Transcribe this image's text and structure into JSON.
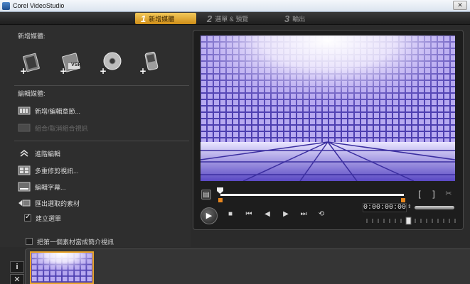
{
  "window": {
    "title": "Corel VideoStudio",
    "close_glyph": "✕"
  },
  "steps": [
    {
      "num": "1",
      "label": "新增媒體",
      "active": true
    },
    {
      "num": "2",
      "label": "選單 & 預覽",
      "active": false
    },
    {
      "num": "3",
      "label": "輸出",
      "active": false
    }
  ],
  "left": {
    "add_media_label": "新增媒體:",
    "capture_icons": [
      "add-video-icon",
      "add-vsp-icon",
      "add-disc-icon",
      "add-device-icon"
    ],
    "vsp_badge": "VSP",
    "edit_media_label": "編輯媒體:",
    "edit_items": [
      {
        "label": "新增/編輯章節...",
        "disabled": false
      },
      {
        "label": "組合/取消組合視訊",
        "disabled": true
      }
    ],
    "advanced_label": "進階編輯",
    "advanced_items": [
      {
        "label": "多重修剪視訊..."
      },
      {
        "label": "編輯字幕..."
      },
      {
        "label": "匯出選取的素材"
      }
    ],
    "create_menu": {
      "label": "建立選單",
      "checked": true
    },
    "first_as_intro": {
      "label": "把第一個素材當成簡介視訊",
      "checked": false
    }
  },
  "player": {
    "timecode": "0:00:00:00",
    "mark_in": "[",
    "mark_out": "]",
    "progress": 0
  },
  "timeline": {
    "info_button": "i",
    "delete_button": "✕"
  },
  "colors": {
    "accent": "#e8a030",
    "panel": "#2e2e2e",
    "preview_purple": "#5e4fbf"
  }
}
